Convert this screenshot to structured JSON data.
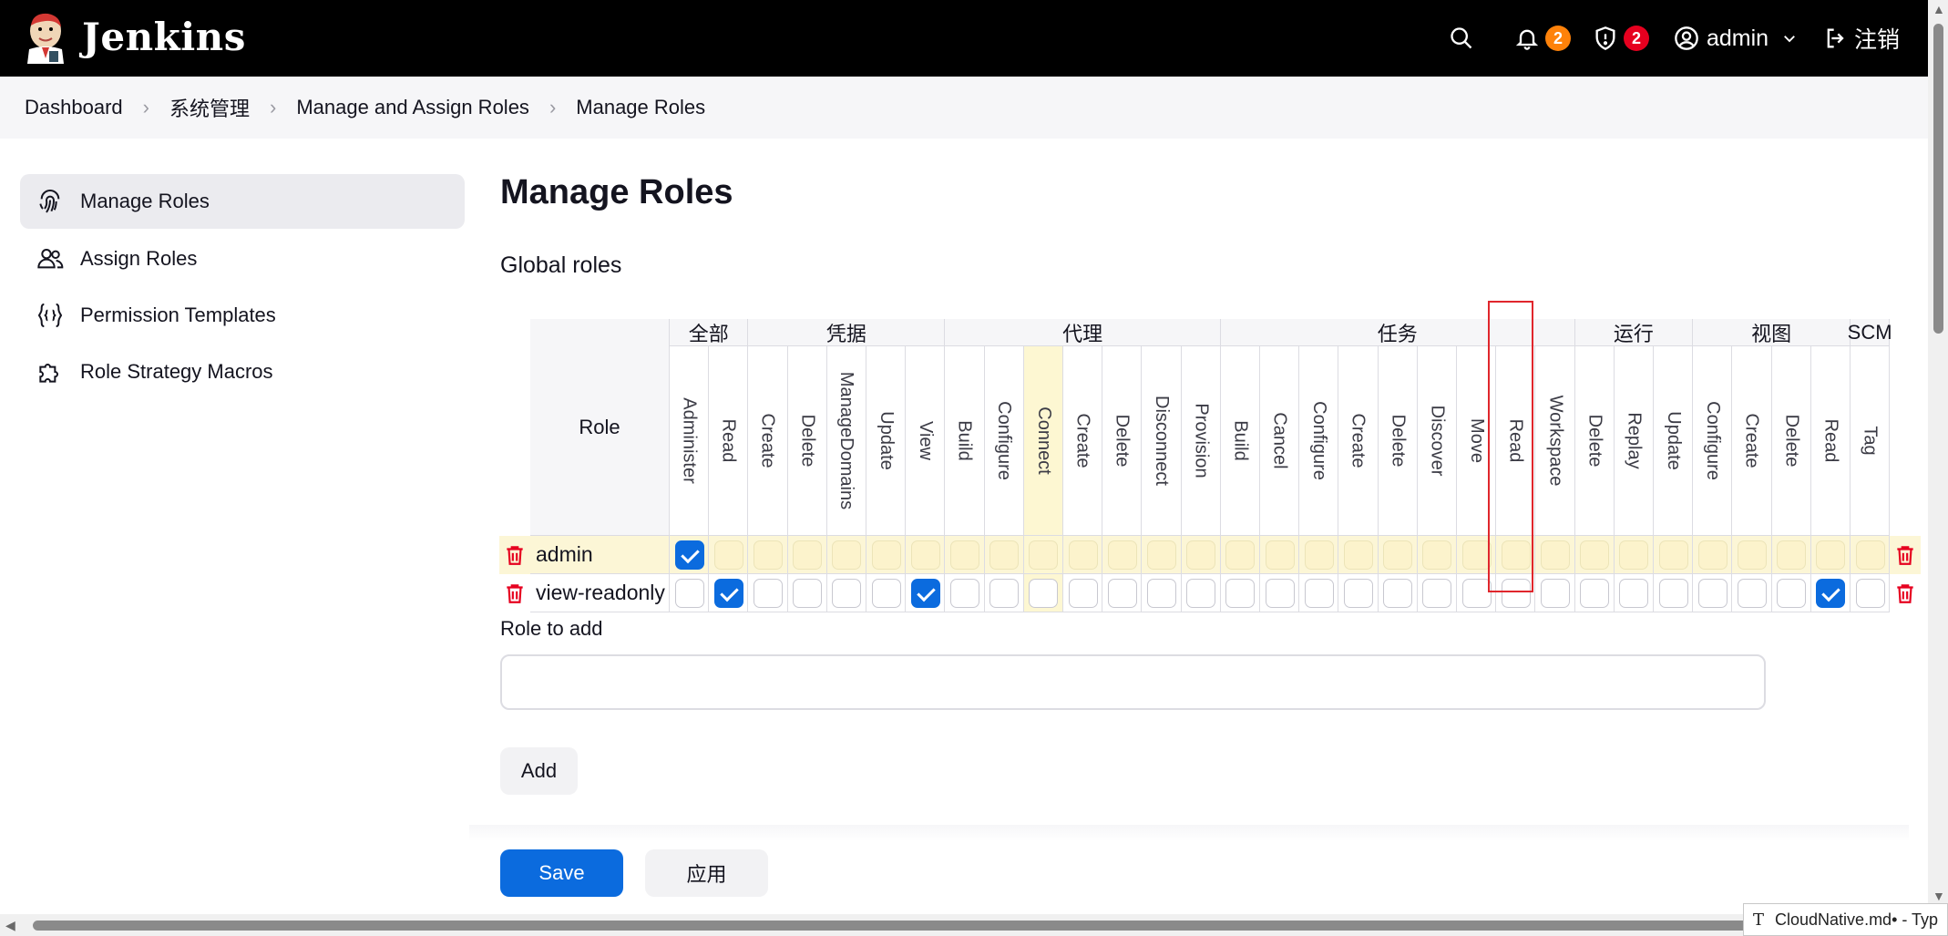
{
  "header": {
    "brand": "Jenkins",
    "notifications_count": "2",
    "security_count": "2",
    "user": "admin",
    "logout_label": "注销"
  },
  "breadcrumb": [
    "Dashboard",
    "系统管理",
    "Manage and Assign Roles",
    "Manage Roles"
  ],
  "sidebar": {
    "items": [
      {
        "label": "Manage Roles",
        "icon": "fingerprint-icon",
        "active": true
      },
      {
        "label": "Assign Roles",
        "icon": "people-icon",
        "active": false
      },
      {
        "label": "Permission Templates",
        "icon": "braces-icon",
        "active": false
      },
      {
        "label": "Role Strategy Macros",
        "icon": "puzzle-icon",
        "active": false
      }
    ]
  },
  "main": {
    "title": "Manage Roles",
    "section": "Global roles",
    "role_header": "Role",
    "groups": [
      {
        "label": "全部",
        "perms": [
          "Administer",
          "Read"
        ]
      },
      {
        "label": "凭据",
        "perms": [
          "Create",
          "Delete",
          "ManageDomains",
          "Update",
          "View"
        ]
      },
      {
        "label": "代理",
        "perms": [
          "Build",
          "Configure",
          "Connect",
          "Create",
          "Delete",
          "Disconnect",
          "Provision"
        ]
      },
      {
        "label": "任务",
        "perms": [
          "Build",
          "Cancel",
          "Configure",
          "Create",
          "Delete",
          "Discover",
          "Move",
          "Read",
          "Workspace"
        ]
      },
      {
        "label": "运行",
        "perms": [
          "Delete",
          "Replay",
          "Update"
        ]
      },
      {
        "label": "视图",
        "perms": [
          "Configure",
          "Create",
          "Delete",
          "Read"
        ]
      },
      {
        "label": "SCM",
        "perms": [
          "Tag"
        ]
      }
    ],
    "roles": [
      {
        "name": "admin",
        "checked": [
          0
        ]
      },
      {
        "name": "view-readonly",
        "checked": [
          1,
          6,
          29
        ]
      }
    ],
    "highlighted_column": 9,
    "role_to_add_label": "Role to add",
    "role_to_add_value": "",
    "add_button": "Add",
    "save_button": "Save",
    "apply_button": "应用"
  },
  "taskbar_tooltip": {
    "icon": "T",
    "text": "CloudNative.md• - Typ"
  },
  "colors": {
    "accent": "#0b6bde",
    "highlight_row": "#fcf6d6",
    "highlight_col": "#fdf7d2",
    "danger": "#e6001f",
    "badge_orange": "#fe820a"
  }
}
